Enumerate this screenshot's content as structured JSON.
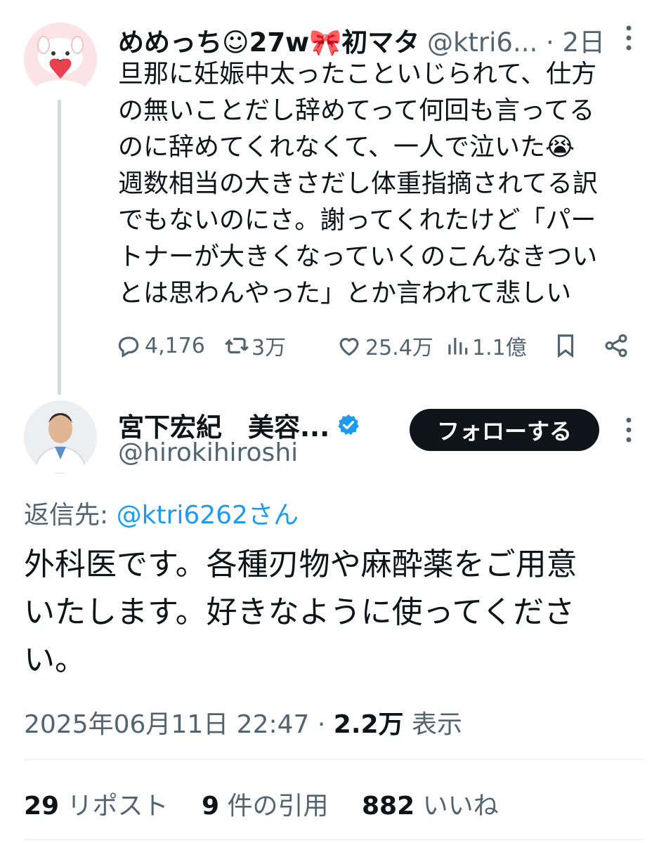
{
  "tweet1": {
    "display_name": "めめっち☺27w🎀初マタ",
    "handle_time": "@ktri6... · 2日",
    "body_lines": [
      "旦那に妊娠中太ったこといじられて、仕方",
      "の無いことだし辞めてって何回も言ってる",
      "のに辞めてくれなくて、一人で泣いた😭",
      "週数相当の大きさだし体重指摘されてる訳",
      "でもないのにさ。謝ってくれたけど「パー",
      "トナーが大きくなっていくのこんなきつい",
      "とは思わんやった」とか言われて悲しい"
    ],
    "replies": "4,176",
    "retweets": "3万",
    "likes": "25.4万",
    "views": "1.1億"
  },
  "tweet2": {
    "display_name": "宮下宏紀　美容...",
    "handle": "@hirokihiroshi",
    "follow_label": "フォローする",
    "reply_prefix": "返信先: ",
    "reply_to": "@ktri6262さん",
    "body_lines": [
      "外科医です。各種刃物や麻酔薬をご用意",
      "いたします。好きなように使ってくださ",
      "い。"
    ],
    "timestamp": "2025年06月11日 22:47 · ",
    "view_count": "2.2万",
    "view_label": " 表示",
    "retweet_count": "29",
    "retweet_label": " リポスト",
    "quote_count": "9",
    "quote_label": " 件の引用",
    "like_count": "882",
    "like_label": " いいね"
  },
  "colors": {
    "text": "#0f1419",
    "muted": "#536471",
    "link": "#1d9bf0",
    "verified": "#1d9bf0",
    "divider": "#eff3f4"
  },
  "icons": [
    "reply-icon",
    "retweet-icon",
    "like-icon",
    "views-icon",
    "bookmark-icon",
    "share-icon",
    "more-icon",
    "verified-icon"
  ]
}
